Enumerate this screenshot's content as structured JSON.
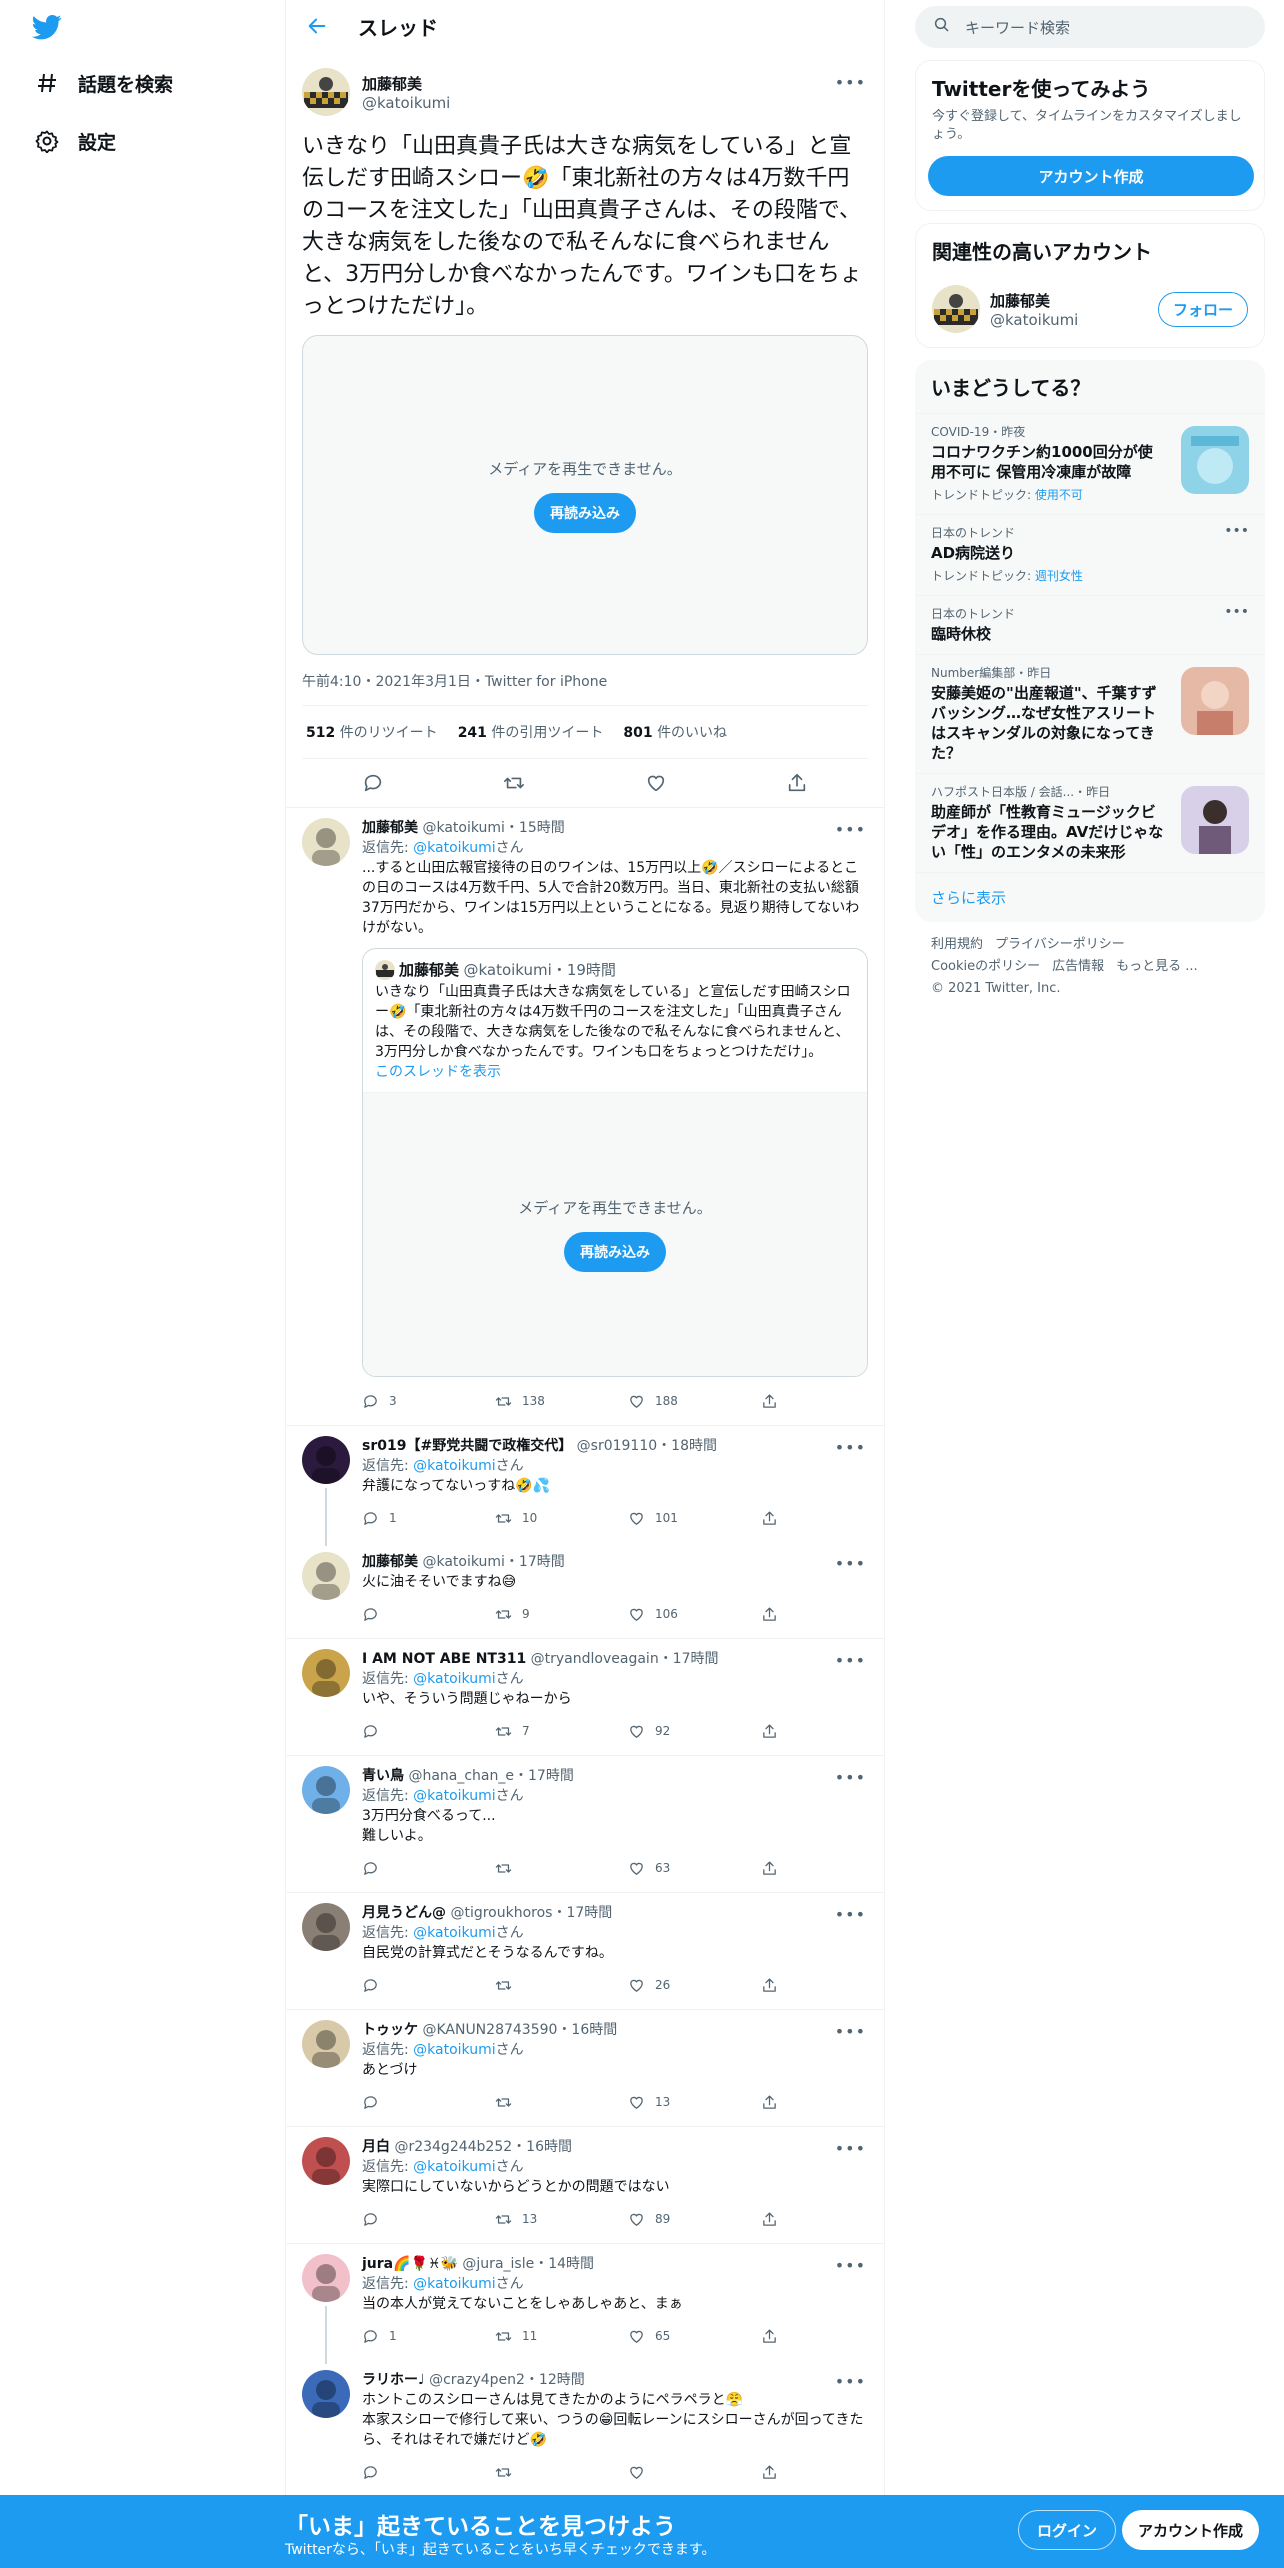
{
  "nav": {
    "explore": "話題を検索",
    "settings": "設定"
  },
  "thread": {
    "title": "スレッド"
  },
  "main_tweet": {
    "name": "加藤郁美",
    "handle": "@katoikumi",
    "text": "いきなり「山田真貴子氏は大きな病気をしている」と宣伝しだす田崎スシロー🤣「東北新社の方々は4万数千円のコースを注文した」「山田真貴子さんは、その段階で、大きな病気をした後なので私そんなに食べられませんと、3万円分しか食べなかったんです。ワインも口をちょっとつけただけ」。",
    "media_message": "メディアを再生できません。",
    "reload": "再読み込み",
    "meta": "午前4:10・2021年3月1日・Twitter for iPhone",
    "stats": {
      "retweets": "512",
      "retweets_label": "件のリツイート",
      "quotes": "241",
      "quotes_label": "件の引用ツイート",
      "likes": "801",
      "likes_label": "件のいいね"
    }
  },
  "replying_label": "返信先:",
  "replying_suffix": "さん",
  "replies": [
    {
      "name": "加藤郁美",
      "handle": "@katoikumi",
      "time": "・15時間",
      "reply_to": "@katoikumi",
      "text": "...すると山田広報官接待の日のワインは、15万円以上🤣／スシローによるとこの日のコースは4万数千円、5人で合計20数万円。当日、東北新社の支払い総額37万円だから、ワインは15万円以上ということになる。見返り期待してないわけがない。",
      "quote": {
        "name": "加藤郁美",
        "handle": "@katoikumi",
        "time": "・19時間",
        "text": "いきなり「山田真貴子氏は大きな病気をしている」と宣伝しだす田崎スシロー🤣「東北新社の方々は4万数千円のコースを注文した」「山田真貴子さんは、その段階で、大きな病気をした後なので私そんなに食べられませんと、3万円分しか食べなかったんです。ワインも口をちょっとつけただけ」。",
        "link": "このスレッドを表示",
        "media_message": "メディアを再生できません。",
        "reload": "再読み込み"
      },
      "replies_count": "3",
      "retweets_count": "138",
      "likes_count": "188"
    },
    {
      "name": "sr019【#野党共闘で政権交代】",
      "handle": "@sr019110",
      "time": "・18時間",
      "reply_to": "@katoikumi",
      "text": "弁護になってないっすね🤣💦",
      "replies_count": "1",
      "retweets_count": "10",
      "likes_count": "101"
    },
    {
      "name": "加藤郁美",
      "handle": "@katoikumi",
      "time": "・17時間",
      "text": "火に油そそいでますね😅",
      "replies_count": "",
      "retweets_count": "9",
      "likes_count": "106"
    },
    {
      "name": "I AM NOT ABE NT311",
      "handle": "@tryandloveagain",
      "time": "・17時間",
      "reply_to": "@katoikumi",
      "text": "いや、そういう問題じゃねーから",
      "replies_count": "",
      "retweets_count": "7",
      "likes_count": "92"
    },
    {
      "name": "青い鳥",
      "handle": "@hana_chan_e",
      "time": "・17時間",
      "reply_to": "@katoikumi",
      "text": "3万円分食べるって...\n難しいよ。",
      "replies_count": "",
      "retweets_count": "",
      "likes_count": "63"
    },
    {
      "name": "月見うどん@",
      "handle": "@tigroukhoros",
      "time": "・17時間",
      "reply_to": "@katoikumi",
      "text": "自民党の計算式だとそうなるんですね。",
      "replies_count": "",
      "retweets_count": "",
      "likes_count": "26"
    },
    {
      "name": "トゥッケ",
      "handle": "@KANUN28743590",
      "time": "・16時間",
      "reply_to": "@katoikumi",
      "text": "あとづけ",
      "replies_count": "",
      "retweets_count": "",
      "likes_count": "13"
    },
    {
      "name": "月白",
      "handle": "@r234g244b252",
      "time": "・16時間",
      "reply_to": "@katoikumi",
      "text": "実際口にしていないからどうとかの問題ではない",
      "replies_count": "",
      "retweets_count": "13",
      "likes_count": "89"
    },
    {
      "name": "jura🌈🌹♓🐝",
      "handle": "@jura_isle",
      "time": "・14時間",
      "reply_to": "@katoikumi",
      "text": "当の本人が覚えてないことをしゃあしゃあと、まぁ",
      "replies_count": "1",
      "retweets_count": "11",
      "likes_count": "65"
    },
    {
      "name": "ラリホー♩",
      "handle": "@crazy4pen2",
      "time": "・12時間",
      "text": "ホントこのスシローさんは見てきたかのようにペラペラと😤\n本家スシローで修行して来い、つうの😁回転レーンにスシローさんが回ってきたら、それはそれで嫌だけど🤣",
      "replies_count": "",
      "retweets_count": "",
      "likes_count": ""
    }
  ],
  "right": {
    "search_placeholder": "キーワード検索",
    "join_title": "Twitterを使ってみよう",
    "join_sub": "今すぐ登録して、タイムラインをカスタマイズしましょう。",
    "signup": "アカウント作成",
    "related_title": "関連性の高いアカウント",
    "related_name": "加藤郁美",
    "related_handle": "@katoikumi",
    "follow": "フォロー",
    "trends_title": "いまどうしてる？",
    "trends": [
      {
        "ctx": "COVID-19・昨夜",
        "title": "コロナワクチン約1000回分が使用不可に 保管用冷凍庫が故障",
        "topic_label": "トレンドトピック:",
        "topic": "使用不可"
      },
      {
        "ctx": "日本のトレンド",
        "title": "AD病院送り",
        "topic_label": "トレンドトピック:",
        "topic": "週刊女性"
      },
      {
        "ctx": "日本のトレンド",
        "title": "臨時休校"
      },
      {
        "ctx": "Number編集部・昨日",
        "title": "安藤美姫の\"出産報道\"、千葉すずバッシング…なぜ女性アスリートはスキャンダルの対象になってきた？"
      },
      {
        "ctx": "ハフポスト日本版 / 会話...・昨日",
        "title": "助産師が「性教育ミュージックビデオ」を作る理由。AVだけじゃない「性」のエンタメの未来形"
      }
    ],
    "show_more": "さらに表示",
    "footer": [
      "利用規約",
      "プライバシーポリシー",
      "Cookieのポリシー",
      "広告情報",
      "もっと見る ...",
      "© 2021 Twitter, Inc."
    ]
  },
  "bottom": {
    "title": "「いま」起きていることを見つけよう",
    "sub": "Twitterなら、「いま」起きていることをいち早くチェックできます。",
    "login": "ログイン",
    "signup": "アカウント作成"
  },
  "colors": {
    "accent": "#1d9bf0"
  }
}
